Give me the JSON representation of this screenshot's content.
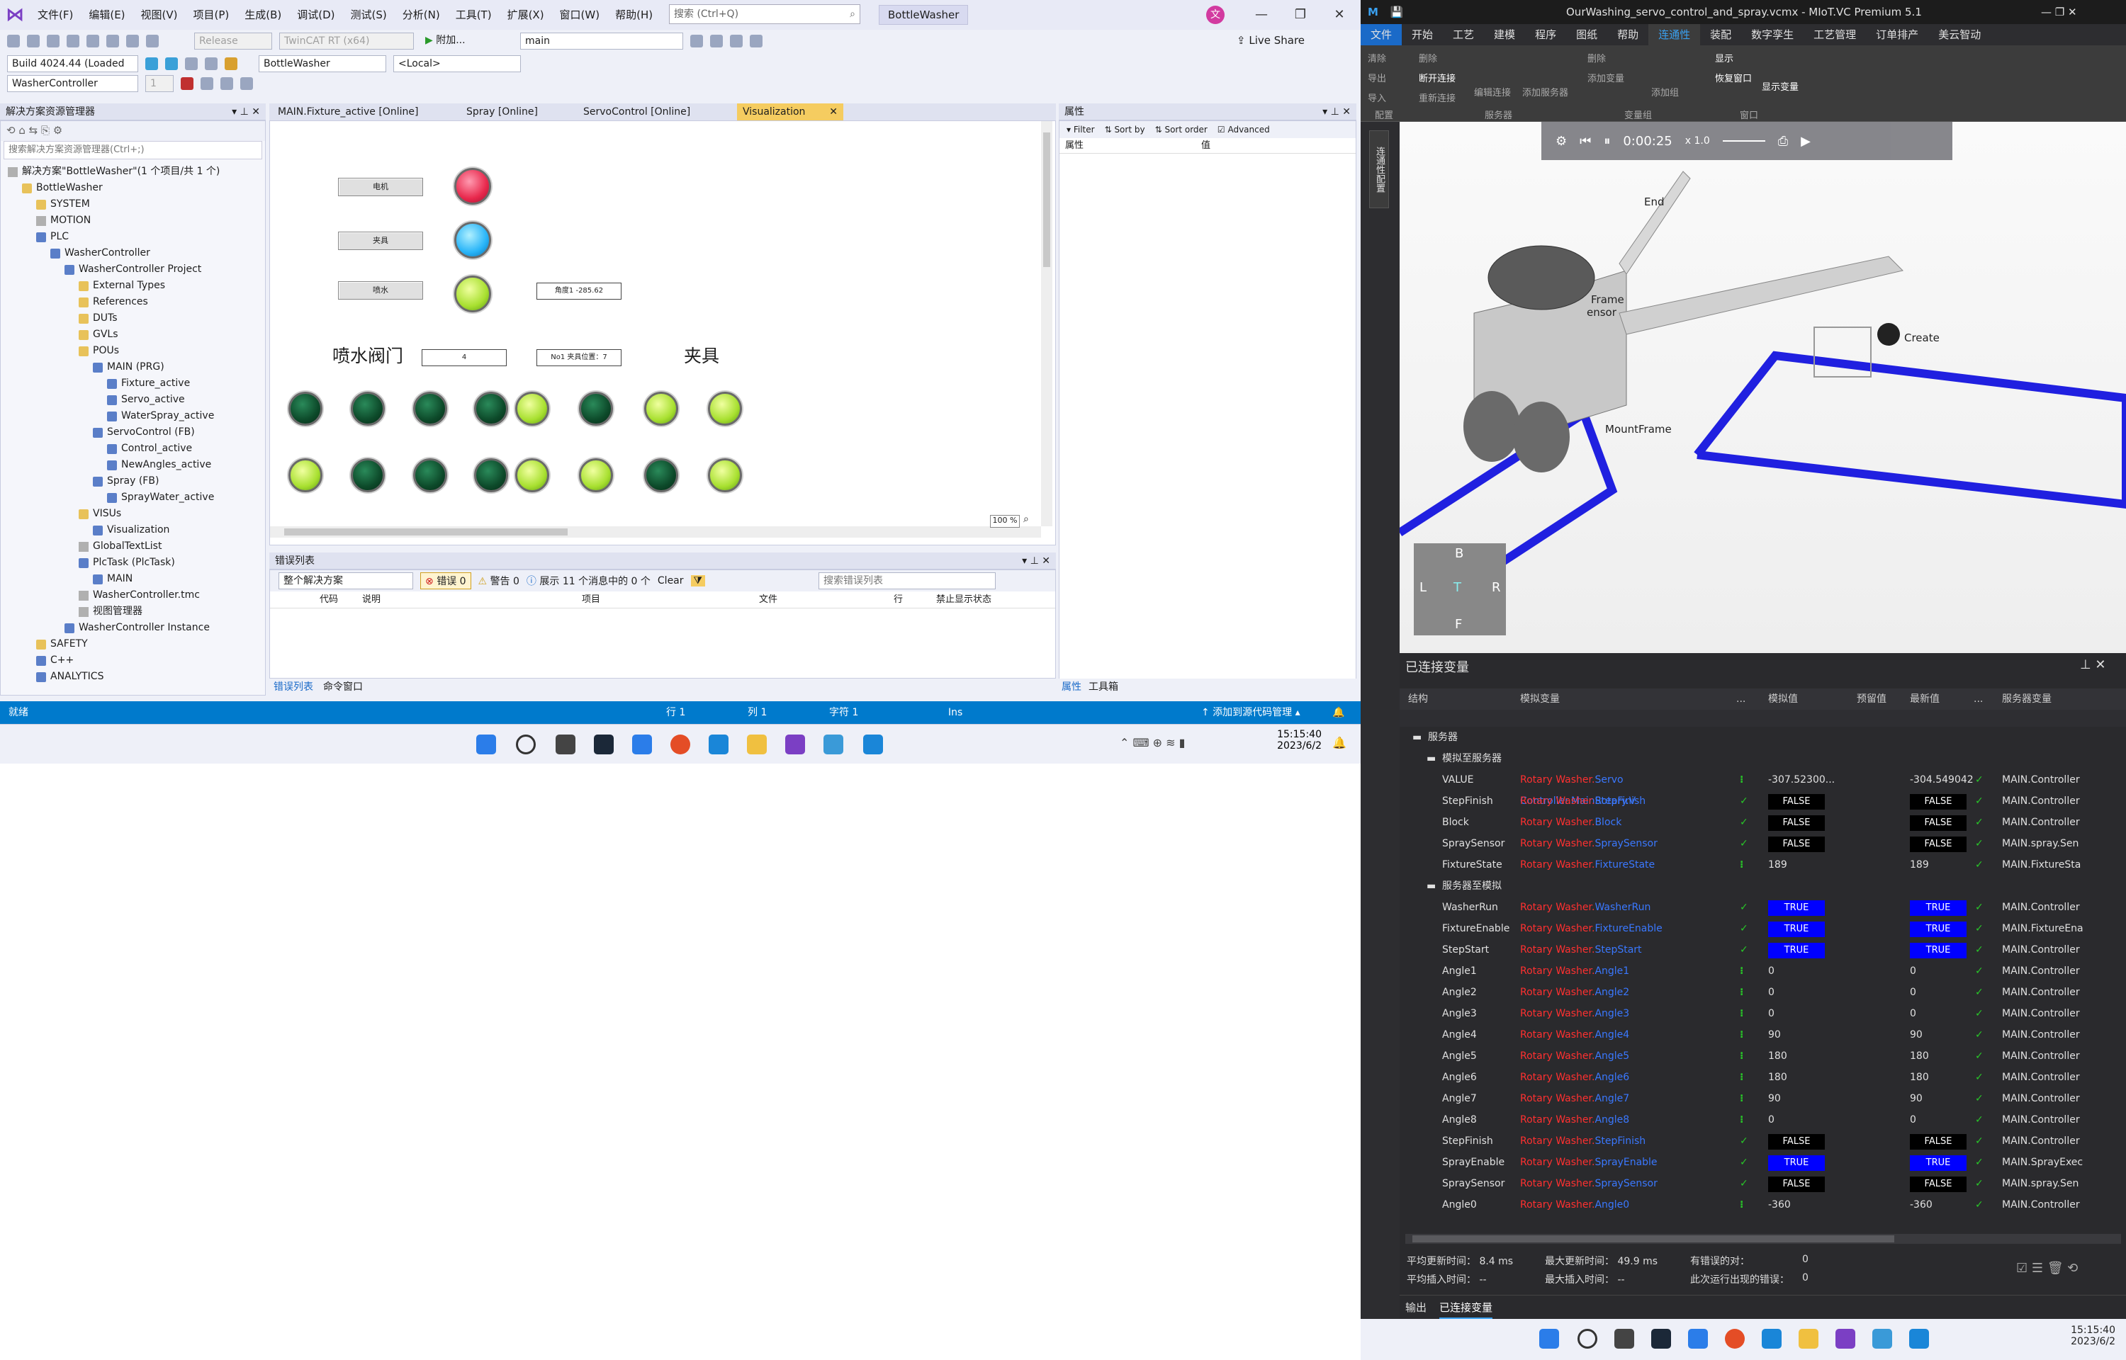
{
  "vs": {
    "menus": [
      "文件(F)",
      "编辑(E)",
      "视图(V)",
      "项目(P)",
      "生成(B)",
      "调试(D)",
      "测试(S)",
      "分析(N)",
      "工具(T)",
      "扩展(X)",
      "窗口(W)",
      "帮助(H)"
    ],
    "search_placeholder": "搜索 (Ctrl+Q)",
    "solution_name": "BottleWasher",
    "avatar": "文",
    "live_share": "Live Share",
    "tb": {
      "release": "Release",
      "target": "TwinCAT RT (x64)",
      "main_combo": "main",
      "attach": "附加...",
      "build": "Build 4024.44 (Loaded",
      "project_combo": "BottleWasher",
      "local": "<Local>",
      "controller_combo": "WasherController",
      "one": "1"
    },
    "explorer": {
      "title": "解决方案资源管理器",
      "search_placeholder": "搜索解决方案资源管理器(Ctrl+;)",
      "items": [
        {
          "label": "解决方案\"BottleWasher\"(1 个项目/共 1 个)",
          "indent": 0,
          "icon": "icg"
        },
        {
          "label": "BottleWasher",
          "indent": 1,
          "icon": "icf"
        },
        {
          "label": "SYSTEM",
          "indent": 2,
          "icon": "icf"
        },
        {
          "label": "MOTION",
          "indent": 2,
          "icon": "icg"
        },
        {
          "label": "PLC",
          "indent": 2,
          "icon": "icp"
        },
        {
          "label": "WasherController",
          "indent": 3,
          "icon": "icp"
        },
        {
          "label": "WasherController Project",
          "indent": 4,
          "icon": "icp"
        },
        {
          "label": "External Types",
          "indent": 5,
          "icon": "icf"
        },
        {
          "label": "References",
          "indent": 5,
          "icon": "icf"
        },
        {
          "label": "DUTs",
          "indent": 5,
          "icon": "icf"
        },
        {
          "label": "GVLs",
          "indent": 5,
          "icon": "icf"
        },
        {
          "label": "POUs",
          "indent": 5,
          "icon": "icf"
        },
        {
          "label": "MAIN (PRG)",
          "indent": 6,
          "icon": "icp"
        },
        {
          "label": "Fixture_active",
          "indent": 7,
          "icon": "icp"
        },
        {
          "label": "Servo_active",
          "indent": 7,
          "icon": "icp"
        },
        {
          "label": "WaterSpray_active",
          "indent": 7,
          "icon": "icp"
        },
        {
          "label": "ServoControl (FB)",
          "indent": 6,
          "icon": "icp"
        },
        {
          "label": "Control_active",
          "indent": 7,
          "icon": "icp"
        },
        {
          "label": "NewAngles_active",
          "indent": 7,
          "icon": "icp"
        },
        {
          "label": "Spray (FB)",
          "indent": 6,
          "icon": "icp"
        },
        {
          "label": "SprayWater_active",
          "indent": 7,
          "icon": "icp"
        },
        {
          "label": "VISUs",
          "indent": 5,
          "icon": "icf"
        },
        {
          "label": "Visualization",
          "indent": 6,
          "icon": "icp"
        },
        {
          "label": "GlobalTextList",
          "indent": 5,
          "icon": "icg"
        },
        {
          "label": "PlcTask (PlcTask)",
          "indent": 5,
          "icon": "icp"
        },
        {
          "label": "MAIN",
          "indent": 6,
          "icon": "icp"
        },
        {
          "label": "WasherController.tmc",
          "indent": 5,
          "icon": "icg"
        },
        {
          "label": "视图管理器",
          "indent": 5,
          "icon": "icg"
        },
        {
          "label": "WasherController Instance",
          "indent": 4,
          "icon": "icp"
        },
        {
          "label": "SAFETY",
          "indent": 2,
          "icon": "icf"
        },
        {
          "label": "C++",
          "indent": 2,
          "icon": "icp"
        },
        {
          "label": "ANALYTICS",
          "indent": 2,
          "icon": "icp"
        }
      ]
    },
    "doc_tabs": [
      "MAIN.Fixture_active [Online]",
      "Spray [Online]",
      "ServoControl [Online]",
      "Visualization"
    ],
    "visu": {
      "btn_motor": "电机",
      "btn_fixture": "夹具",
      "btn_spray": "喷水",
      "angle_box": "角度1 -285.62",
      "valve_title": "喷水阀门",
      "fixture_title": "夹具",
      "valve_num": "4",
      "fixture_pos": "No1 夹具位置：7",
      "zoom": "100 %"
    },
    "props": {
      "title": "属性",
      "filter": "Filter",
      "sort_by": "Sort by",
      "sort_order": "Sort order",
      "advanced": "Advanced",
      "col1": "属性",
      "col2": "值",
      "tab_props": "属性",
      "tab_toolbox": "工具箱"
    },
    "errors": {
      "title": "错误列表",
      "scope": "整个解决方案",
      "err": "错误 0",
      "warn": "警告 0",
      "msg": "展示 11 个消息中的 0 个",
      "clear": "Clear",
      "search_placeholder": "搜索错误列表",
      "cols": [
        "代码",
        "说明",
        "项目",
        "文件",
        "行",
        "禁止显示状态"
      ],
      "tab1": "错误列表",
      "tab2": "命令窗口"
    },
    "status": {
      "ready": "就绪",
      "row": "行 1",
      "col": "列 1",
      "char": "字符 1",
      "ins": "Ins",
      "source_ctrl": "添加到源代码管理"
    },
    "clock": {
      "time": "15:15:40",
      "date": "2023/6/2"
    }
  },
  "vc": {
    "title": "OurWashing_servo_control_and_spray.vcmx - MIoT.VC Premium 5.1",
    "tabs": [
      "文件",
      "开始",
      "工艺",
      "建模",
      "程序",
      "图纸",
      "帮助",
      "连通性",
      "装配",
      "数字孪生",
      "工艺管理",
      "订单排产",
      "美云智动"
    ],
    "ribbon": {
      "clear": "清除",
      "export": "导出",
      "import": "导入",
      "config": "配置",
      "delete": "删除",
      "disconnect": "断开连接",
      "reconnect": "重新连接",
      "edit_conn": "编辑连接",
      "add_server": "添加服务器",
      "server": "服务器",
      "del_var": "删除",
      "add_var": "添加变量",
      "add_group": "添加组",
      "var_group": "变量组",
      "show": "显示",
      "restore_win": "恢复窗口",
      "show_vars": "显示变量",
      "window": "窗口"
    },
    "side_tab": "连通性配置",
    "sim": {
      "time": "0:00:25",
      "speed": "x 1.0"
    },
    "scene_labels": [
      "End",
      "MountFrame",
      "Create",
      "Frame",
      "ensor"
    ],
    "cube": {
      "top": "B",
      "front": "T",
      "left": "L",
      "right": "R",
      "bottom": "F"
    },
    "panel_title": "已连接变量",
    "cols": [
      "结构",
      "模拟变量",
      "...",
      "模拟值",
      "预留值",
      "最新值",
      "...",
      "服务器变量"
    ],
    "group_server": "服务器",
    "group_sim2srv": "模拟至服务器",
    "group_srv2sim": "服务器至模拟",
    "rows_a": [
      {
        "name": "VALUE",
        "path": "Servo Controller.MainRotary.V",
        "sim": "-307.52300...",
        "latest": "-304.549042",
        "srv": "MAIN.Controller"
      },
      {
        "name": "StepFinish",
        "path": "StepFinish",
        "sim": "FALSE",
        "latest": "FALSE",
        "srv": "MAIN.Controller"
      },
      {
        "name": "Block",
        "path": "Block",
        "sim": "FALSE",
        "latest": "FALSE",
        "srv": "MAIN.Controller"
      },
      {
        "name": "SpraySensor",
        "path": "SpraySensor",
        "sim": "FALSE",
        "latest": "FALSE",
        "srv": "MAIN.spray.Sen"
      },
      {
        "name": "FixtureState",
        "path": "FixtureState",
        "sim": "189",
        "latest": "189",
        "srv": "MAIN.FixtureSta"
      }
    ],
    "rows_b": [
      {
        "name": "WasherRun",
        "path": "WasherRun",
        "sim": "TRUE",
        "latest": "TRUE",
        "srv": "MAIN.Controller"
      },
      {
        "name": "FixtureEnable",
        "path": "FixtureEnable",
        "sim": "TRUE",
        "latest": "TRUE",
        "srv": "MAIN.FixtureEna"
      },
      {
        "name": "StepStart",
        "path": "StepStart",
        "sim": "TRUE",
        "latest": "TRUE",
        "srv": "MAIN.Controller"
      },
      {
        "name": "Angle1",
        "path": "Angle1",
        "sim": "0",
        "latest": "0",
        "srv": "MAIN.Controller"
      },
      {
        "name": "Angle2",
        "path": "Angle2",
        "sim": "0",
        "latest": "0",
        "srv": "MAIN.Controller"
      },
      {
        "name": "Angle3",
        "path": "Angle3",
        "sim": "0",
        "latest": "0",
        "srv": "MAIN.Controller"
      },
      {
        "name": "Angle4",
        "path": "Angle4",
        "sim": "90",
        "latest": "90",
        "srv": "MAIN.Controller"
      },
      {
        "name": "Angle5",
        "path": "Angle5",
        "sim": "180",
        "latest": "180",
        "srv": "MAIN.Controller"
      },
      {
        "name": "Angle6",
        "path": "Angle6",
        "sim": "180",
        "latest": "180",
        "srv": "MAIN.Controller"
      },
      {
        "name": "Angle7",
        "path": "Angle7",
        "sim": "90",
        "latest": "90",
        "srv": "MAIN.Controller"
      },
      {
        "name": "Angle8",
        "path": "Angle8",
        "sim": "0",
        "latest": "0",
        "srv": "MAIN.Controller"
      },
      {
        "name": "StepFinish",
        "path": "StepFinish",
        "sim": "FALSE",
        "latest": "FALSE",
        "srv": "MAIN.Controller"
      },
      {
        "name": "SprayEnable",
        "path": "SprayEnable",
        "sim": "TRUE",
        "latest": "TRUE",
        "srv": "MAIN.SprayExec"
      },
      {
        "name": "SpraySensor",
        "path": "SpraySensor",
        "sim": "FALSE",
        "latest": "FALSE",
        "srv": "MAIN.spray.Sen"
      },
      {
        "name": "Angle0",
        "path": "Angle0",
        "sim": "-360",
        "latest": "-360",
        "srv": "MAIN.Controller"
      }
    ],
    "path_prefix": "Rotary Washer.",
    "stats": {
      "avg_update_lbl": "平均更新时间：",
      "avg_update": "8.4 ms",
      "max_update_lbl": "最大更新时间：",
      "max_update": "49.9 ms",
      "err_pairs_lbl": "有错误的对：",
      "err_pairs": "0",
      "avg_insert_lbl": "平均插入时间：",
      "avg_insert": "--",
      "max_insert_lbl": "最大插入时间：",
      "max_insert": "--",
      "run_err_lbl": "此次运行出现的错误：",
      "run_err": "0"
    },
    "bottom_tabs": [
      "输出",
      "已连接变量"
    ],
    "clock": {
      "time": "15:15:40",
      "date": "2023/6/2"
    }
  }
}
